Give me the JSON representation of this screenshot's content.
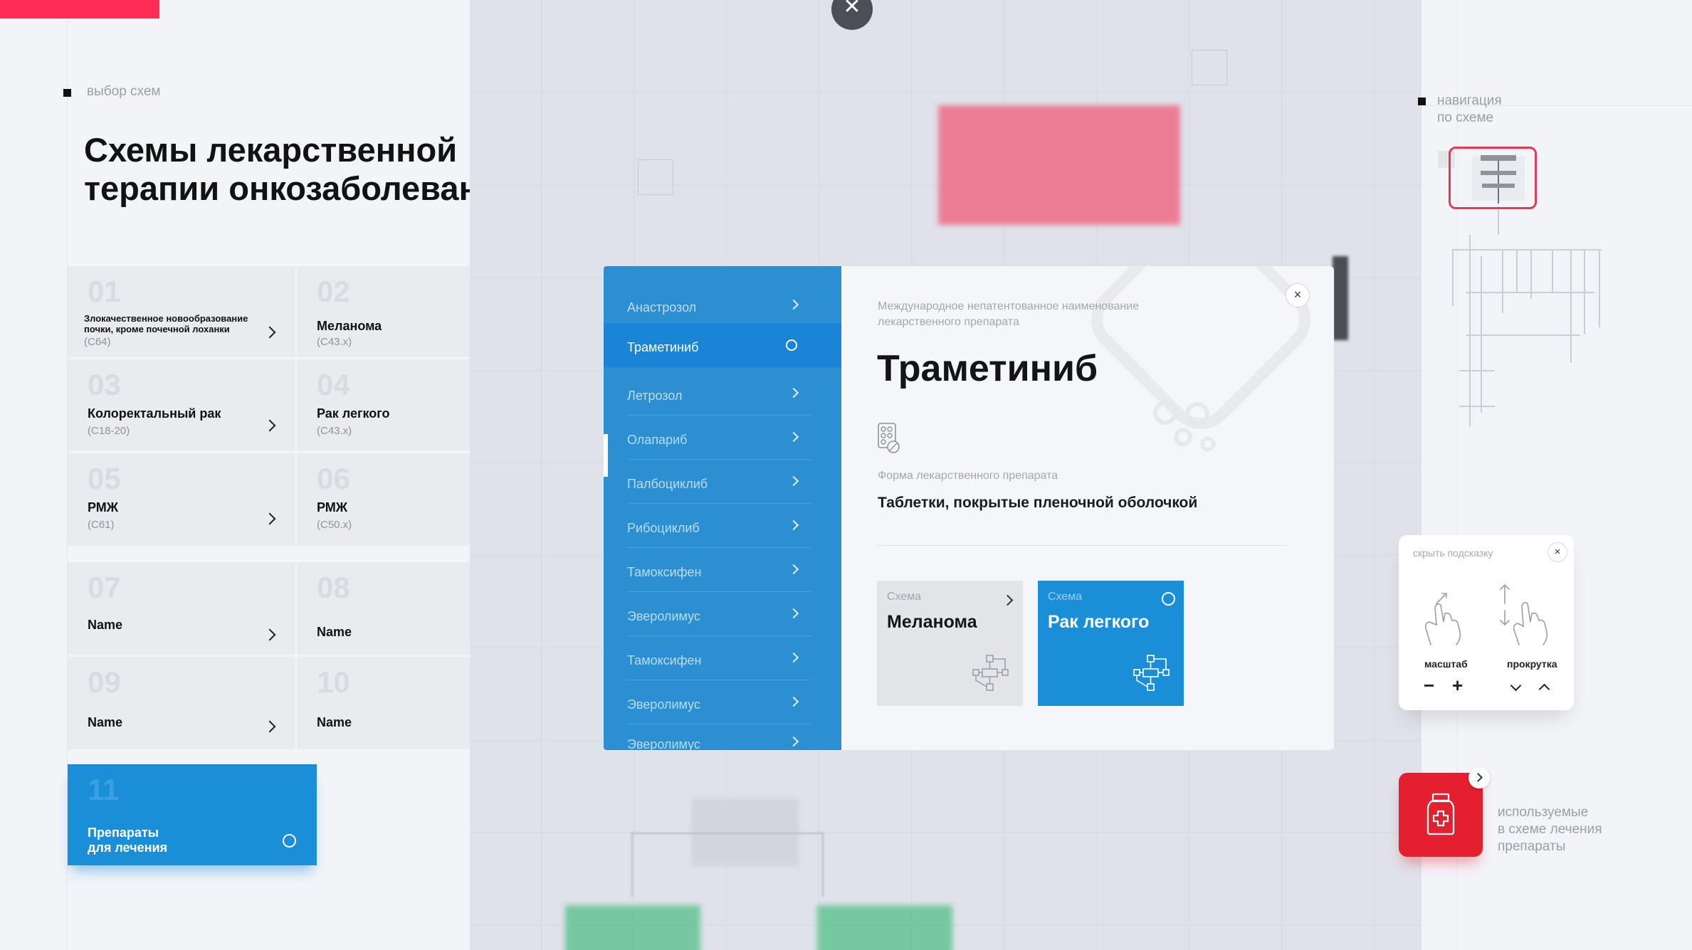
{
  "colors": {
    "accent_red": "#ff2d55",
    "brand_blue": "#1a8fd8",
    "list_blue": "#2c8fd1",
    "danger_red": "#e4202f"
  },
  "left": {
    "section_label": "выбор схем",
    "title_line1": "Схемы лекарственной",
    "title_line2": "терапии онкозаболеваний",
    "cards": [
      {
        "num": "01",
        "title": "Злокачественное новообразование почки, кроме почечной лоханки",
        "code": "(C64)"
      },
      {
        "num": "02",
        "title": "Меланома",
        "code": "(C43.x)"
      },
      {
        "num": "03",
        "title": "Колоректальный рак",
        "code": "(C18-20)"
      },
      {
        "num": "04",
        "title": "Рак легкого",
        "code": "(C43.x)"
      },
      {
        "num": "05",
        "title": "РМЖ",
        "code": "(C61)"
      },
      {
        "num": "06",
        "title": "РМЖ",
        "code": "(C50.x)"
      },
      {
        "num": "07",
        "title": "Name",
        "code": ""
      },
      {
        "num": "08",
        "title": "Name",
        "code": ""
      },
      {
        "num": "09",
        "title": "Name",
        "code": ""
      },
      {
        "num": "10",
        "title": "Name",
        "code": ""
      }
    ],
    "drugs_card": {
      "num": "11",
      "title_line1": "Препараты",
      "title_line2": "для лечения"
    }
  },
  "top_close": "✕",
  "modal": {
    "drug_list": [
      "Анастрозол",
      "Траметиниб",
      "Летрозол",
      "Олапариб",
      "Палбоциклиб",
      "Рибоциклиб",
      "Тамоксифен",
      "Эверолимус",
      "Тамоксифен",
      "Эверолимус",
      "Эверолимус"
    ],
    "active_index": 1,
    "close": "×",
    "inn_label": "Международное непатентованное наименование лекарственного препарата",
    "drug_name": "Траметиниб",
    "pill_icon": "pill-blister-icon",
    "form_label": "Форма лекарственного препарата",
    "form_value": "Таблетки, покрытые пленочной оболочкой",
    "schemes": [
      {
        "key": "Схема",
        "value": "Меланома",
        "selected": false
      },
      {
        "key": "Схема",
        "value": "Рак легкого",
        "selected": true
      }
    ]
  },
  "right": {
    "section_label_line1": "навигация",
    "section_label_line2": "по схеме",
    "hint": {
      "hide": "скрыть подсказку",
      "close": "×",
      "zoom_label": "масштаб",
      "scroll_label": "прокрутка",
      "zoom_out": "−",
      "zoom_in": "+"
    },
    "drugs_caption_line1": "используемые",
    "drugs_caption_line2": "в схеме лечения",
    "drugs_caption_line3": "препараты"
  }
}
